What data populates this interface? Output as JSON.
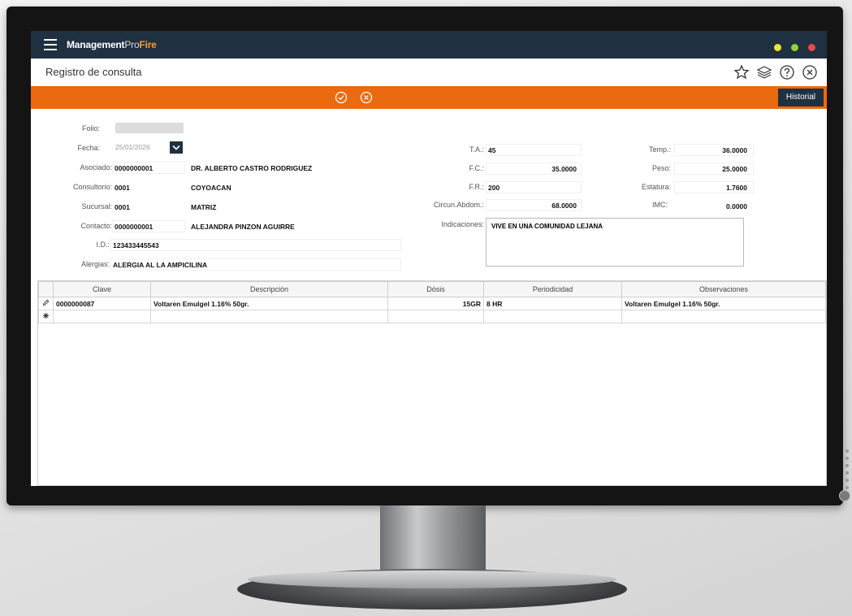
{
  "app": {
    "brand_main": "Management",
    "brand_pro": "Pro",
    "brand_fire": "Fire",
    "window_dot_colors": [
      "#f0e23a",
      "#8fd23a",
      "#e84a4a"
    ]
  },
  "header": {
    "title": "Registro de consulta"
  },
  "icons": [
    "star-icon",
    "layers-icon",
    "help-icon",
    "close-icon",
    "check-icon",
    "cancel-icon",
    "calendar-icon",
    "edit-pencil-icon",
    "new-row-icon",
    "menu-icon"
  ],
  "actionbar": {
    "historial_label": "Historial",
    "accent": "#ec6a0f"
  },
  "form": {
    "folio_label": "Folio:",
    "fecha_label": "Fecha:",
    "fecha_value": "25/01/2026",
    "asociado_label": "Asociado:",
    "asociado_code": "0000000001",
    "asociado_name": "DR. ALBERTO CASTRO RODRIGUEZ",
    "consultorio_label": "Consultorio:",
    "consultorio_code": "0001",
    "consultorio_name": "COYOACAN",
    "sucursal_label": "Sucursal:",
    "sucursal_code": "0001",
    "sucursal_name": "MATRIZ",
    "contacto_label": "Contacto:",
    "contacto_code": "0000000001",
    "contacto_name": "ALEJANDRA PINZON AGUIRRE",
    "id_label": "I.D.:",
    "id_value": "123433445543",
    "alergias_label": "Alergias:",
    "alergias_value": "ALERGIA AL LA AMPICILINA",
    "ta_label": "T.A.:",
    "ta_value": "45",
    "fc_label": "F.C.:",
    "fc_value": "35.0000",
    "fr_label": "F.R.:",
    "fr_value": "200",
    "circun_label": "Circun.Abdom.:",
    "circun_value": "68.0000",
    "indicaciones_label": "Indicaciones:",
    "indicaciones_value": "VIVE EN UNA COMUNIDAD LEJANA",
    "temp_label": "Temp.:",
    "temp_value": "36.0000",
    "peso_label": "Peso:",
    "peso_value": "25.0000",
    "estatura_label": "Estatura:",
    "estatura_value": "1.7600",
    "imc_label": "IMC:",
    "imc_value": "0.0000"
  },
  "grid": {
    "headers": [
      "Clave",
      "Descripción",
      "Dósis",
      "Periodicidad",
      "Observaciones"
    ],
    "rows": [
      {
        "clave": "0000000087",
        "descripcion": "Voltaren Emulgel 1.16% 50gr.",
        "dosis": "15GR",
        "periodicidad": "8 HR",
        "observaciones": "Voltaren Emulgel 1.16% 50gr."
      }
    ]
  }
}
